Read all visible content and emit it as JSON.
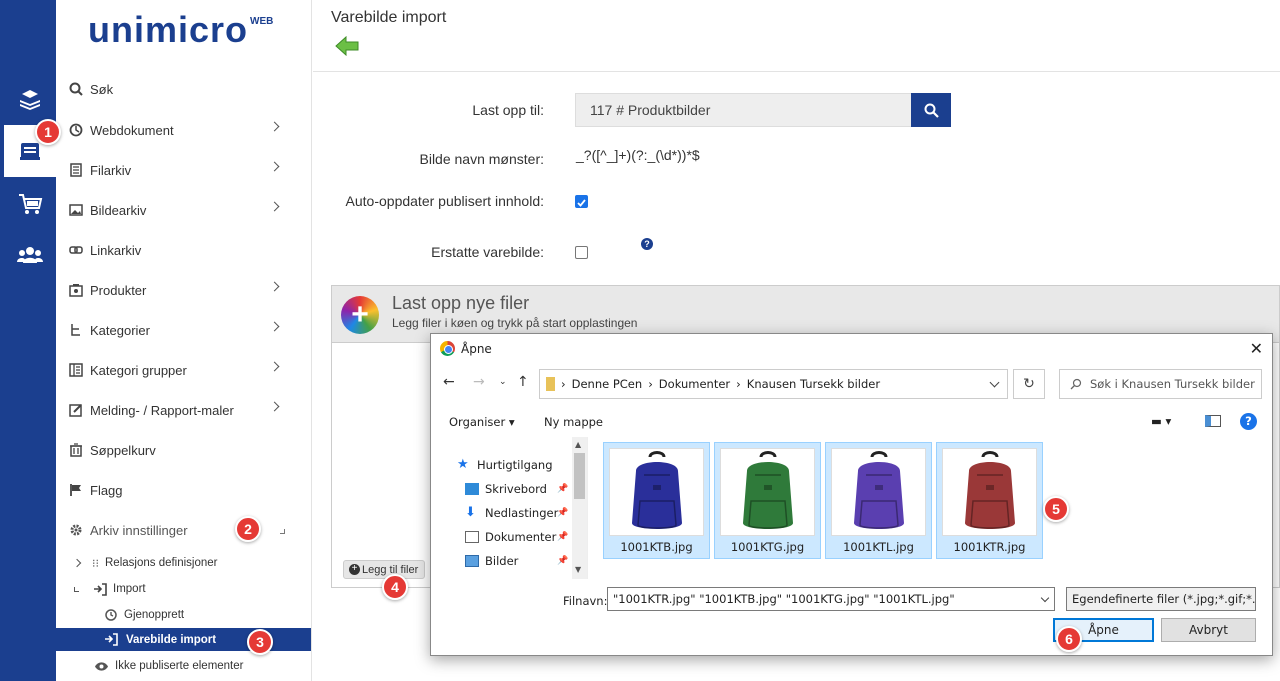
{
  "app": {
    "logo_main": "unimicro",
    "logo_suffix": "WEB",
    "brand_color": "#1b3f8f"
  },
  "rail": [
    "books-icon",
    "archive-icon",
    "cart-icon",
    "users-icon"
  ],
  "menu": {
    "items": [
      {
        "label": "Søk",
        "icon": "search-icon"
      },
      {
        "label": "Webdokument",
        "icon": "globe-icon"
      },
      {
        "label": "Filarkiv",
        "icon": "file-archive-icon"
      },
      {
        "label": "Bildearkiv",
        "icon": "image-icon"
      },
      {
        "label": "Linkarkiv",
        "icon": "link-icon"
      },
      {
        "label": "Produkter",
        "icon": "box-icon"
      },
      {
        "label": "Kategorier",
        "icon": "tree-icon"
      },
      {
        "label": "Kategori grupper",
        "icon": "list-icon"
      },
      {
        "label": "Melding- / Rapport-maler",
        "icon": "edit-icon"
      },
      {
        "label": "Søppelkurv",
        "icon": "trash-icon"
      },
      {
        "label": "Flagg",
        "icon": "flag-icon"
      },
      {
        "label": "Arkiv innstillinger",
        "icon": "gear-icon"
      }
    ],
    "sub_items": [
      {
        "label": "Relasjons definisjoner"
      },
      {
        "label": "Import"
      },
      {
        "label": "Gjenopprett"
      },
      {
        "label": "Varebilde import"
      },
      {
        "label": "Ikke publiserte elementer"
      }
    ]
  },
  "badges": [
    "1",
    "2",
    "3",
    "4",
    "5",
    "6"
  ],
  "page": {
    "title": "Varebilde import",
    "upload_to_label": "Last opp til:",
    "upload_to_value": "117 # Produktbilder",
    "pattern_label": "Bilde navn mønster:",
    "pattern_value": "_?([^_]+)(?:_(\\d*))*$",
    "auto_update_label": "Auto-oppdater publisert innhold:",
    "auto_update_checked": true,
    "replace_label": "Erstatte varebilde:",
    "replace_checked": false,
    "help": "?"
  },
  "upload": {
    "title": "Last opp nye filer",
    "subtitle": "Legg filer i køen og trykk på start opplastingen",
    "add_files": "Legg til filer",
    "add_icon": "+"
  },
  "dialog": {
    "title": "Åpne",
    "path": [
      "Denne PCen",
      "Dokumenter",
      "Knausen Tursekk bilder"
    ],
    "search_placeholder": "Søk i Knausen Tursekk bilder",
    "toolbar": {
      "organise": "Organiser",
      "new_folder": "Ny mappe"
    },
    "tree": [
      {
        "label": "Hurtigtilgang",
        "icon": "star-icon"
      },
      {
        "label": "Skrivebord",
        "icon": "desktop-icon"
      },
      {
        "label": "Nedlastinger",
        "icon": "download-icon"
      },
      {
        "label": "Dokumenter",
        "icon": "document-icon"
      },
      {
        "label": "Bilder",
        "icon": "pictures-icon"
      }
    ],
    "files": [
      {
        "name": "1001KTB.jpg",
        "color": "#2a2f9a"
      },
      {
        "name": "1001KTG.jpg",
        "color": "#2f7a3a"
      },
      {
        "name": "1001KTL.jpg",
        "color": "#5a3fb0"
      },
      {
        "name": "1001KTR.jpg",
        "color": "#9a3838"
      }
    ],
    "filename_label": "Filnavn:",
    "filename_value": "\"1001KTR.jpg\" \"1001KTB.jpg\" \"1001KTG.jpg\" \"1001KTL.jpg\"",
    "filetype": "Egendefinerte filer (*.jpg;*.gif;*.",
    "open": "Åpne",
    "cancel": "Avbryt"
  }
}
